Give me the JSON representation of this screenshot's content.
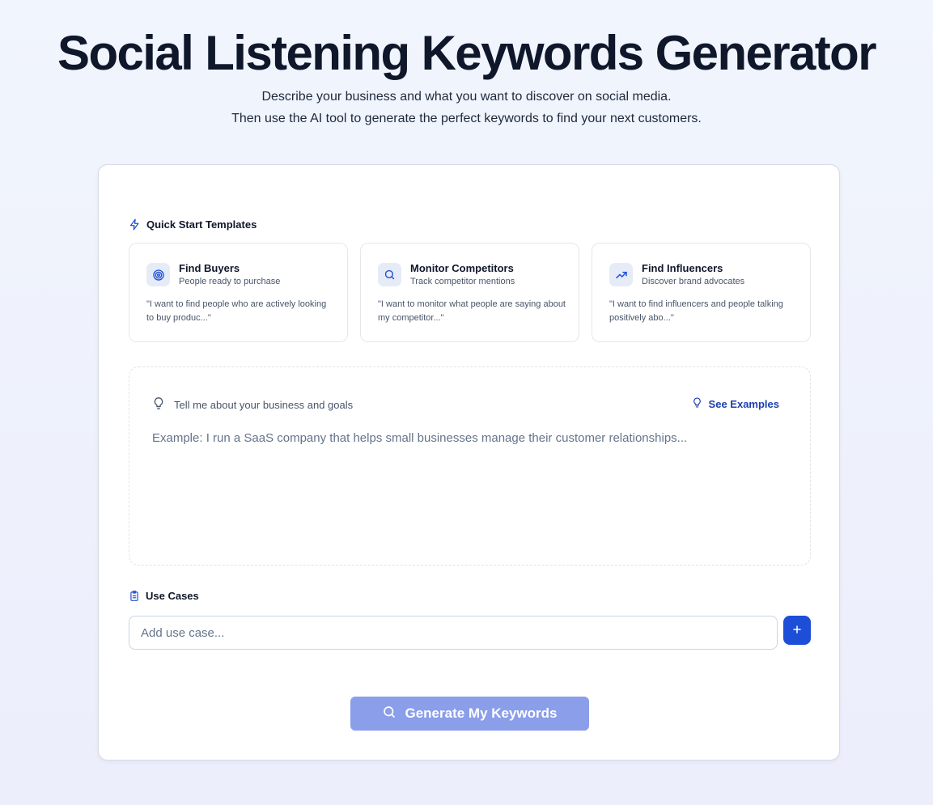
{
  "hero": {
    "title": "Social Listening Keywords Generator",
    "subtitle_line1": "Describe your business and what you want to discover on social media.",
    "subtitle_line2": "Then use the AI tool to generate the perfect keywords to find your next customers."
  },
  "quick_start": {
    "label": "Quick Start Templates",
    "icon": "lightning-icon",
    "templates": [
      {
        "icon": "target-icon",
        "title": "Find Buyers",
        "description": "People ready to purchase",
        "quote": "\"I want to find people who are actively looking to buy produc...\""
      },
      {
        "icon": "search-icon",
        "title": "Monitor Competitors",
        "description": "Track competitor mentions",
        "quote": "\"I want to monitor what people are saying about my competitor...\""
      },
      {
        "icon": "trending-up-icon",
        "title": "Find Influencers",
        "description": "Discover brand advocates",
        "quote": "\"I want to find influencers and people talking positively abo...\""
      }
    ]
  },
  "goals": {
    "label": "Tell me about your business and goals",
    "see_examples": "See Examples",
    "placeholder": "Example: I run a SaaS company that helps small businesses manage their customer relationships...",
    "value": ""
  },
  "use_cases": {
    "label": "Use Cases",
    "input_placeholder": "Add use case...",
    "input_value": ""
  },
  "generate_button": {
    "label": "Generate My Keywords"
  },
  "colors": {
    "primary": "#1d4ed8",
    "primary_disabled": "#8b9eea",
    "icon_bg": "#e6ebf8",
    "accent_text": "#1e40af"
  }
}
